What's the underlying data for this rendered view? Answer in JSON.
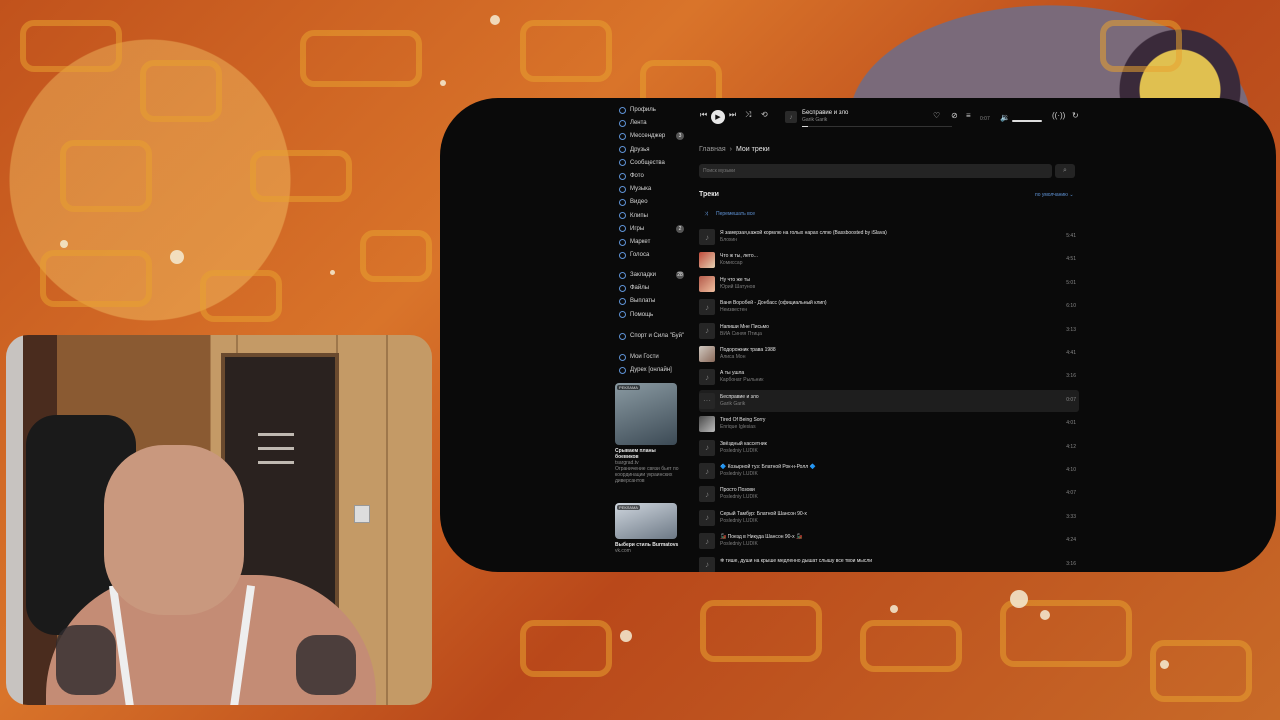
{
  "sidebar": {
    "items": [
      {
        "label": "Профиль",
        "icon": "profile-icon"
      },
      {
        "label": "Лента",
        "icon": "feed-icon"
      },
      {
        "label": "Мессенджер",
        "icon": "messenger-icon",
        "badge": "3"
      },
      {
        "label": "Друзья",
        "icon": "friends-icon"
      },
      {
        "label": "Сообщества",
        "icon": "communities-icon"
      },
      {
        "label": "Фото",
        "icon": "photo-icon"
      },
      {
        "label": "Музыка",
        "icon": "music-icon"
      },
      {
        "label": "Видео",
        "icon": "video-icon"
      },
      {
        "label": "Клипы",
        "icon": "clips-icon"
      },
      {
        "label": "Игры",
        "icon": "games-icon",
        "badge": "2"
      },
      {
        "label": "Маркет",
        "icon": "market-icon"
      },
      {
        "label": "Голоса",
        "icon": "votes-icon"
      }
    ],
    "items2": [
      {
        "label": "Закладки",
        "icon": "bookmarks-icon",
        "badge": "28"
      },
      {
        "label": "Файлы",
        "icon": "files-icon"
      },
      {
        "label": "Выплаты",
        "icon": "payments-icon"
      },
      {
        "label": "Помощь",
        "icon": "help-icon"
      }
    ],
    "group": {
      "label": "Спорт и Сила \"Буй\""
    },
    "items3": [
      {
        "label": "Мои Гости",
        "icon": "guests-icon"
      },
      {
        "label": "Дурех [онлайн]",
        "icon": "app-icon"
      }
    ],
    "ads": [
      {
        "tag": "РЕКЛАМА",
        "title": "Срываем планы боевиков",
        "domain": "tsargrad.tv",
        "desc": "Ограничение связи бьет по координации украинских диверсантов"
      },
      {
        "tag": "РЕКЛАМА",
        "title": "Выбери стиль Burmatovs",
        "domain": "vk.com",
        "desc": ""
      }
    ]
  },
  "player": {
    "title": "Бесправие и зло",
    "artist": "Garik Garik",
    "time": "0:07",
    "progress": 0.04,
    "volume": 0.8
  },
  "breadcrumb": {
    "home": "Главная",
    "current": "Мои треки"
  },
  "search": {
    "placeholder": "Поиск музыки"
  },
  "section": {
    "title": "Треки",
    "sort": "по умолчанию"
  },
  "shuffle": {
    "label": "Перемешать все"
  },
  "tracks": [
    {
      "title": "Я замерзая,кажой кормлю на голых нарах слпю (Bassboosted by iSlava)",
      "artist": "Блохин",
      "duration": "5:41",
      "cover": "note"
    },
    {
      "title": "Что ж ты, лето...",
      "artist": "Комиссар",
      "duration": "4:51",
      "cover": "photo"
    },
    {
      "title": "Ну что же ты",
      "artist": "Юрий Шатунов",
      "duration": "5:01",
      "cover": "photo"
    },
    {
      "title": "Ваня Воробей - Донбасс (официальный клип)",
      "artist": "Неизвестен",
      "duration": "6:10",
      "cover": "note"
    },
    {
      "title": "Напиши Мне Письмо",
      "artist": "ВИА Синяя Птица",
      "duration": "3:13",
      "cover": "note"
    },
    {
      "title": "Подорожник трава 1988",
      "artist": "Алиса Мон",
      "duration": "4:41",
      "cover": "photo"
    },
    {
      "title": "А ты ушла",
      "artist": "Карбонат Рыльник",
      "duration": "3:16",
      "cover": "note"
    },
    {
      "title": "Бесправие и зло",
      "artist": "Garik Garik",
      "duration": "0:07",
      "cover": "playing"
    },
    {
      "title": "Tired Of Being Sorry",
      "artist": "Enrique Iglesias",
      "duration": "4:01",
      "cover": "photo"
    },
    {
      "title": "Звёздный кассетник",
      "artist": "Posledniy LUDIK",
      "duration": "4:12",
      "cover": "note"
    },
    {
      "title": "🔷 Козырной туз: Блатной Рок-н-Ролл 🔷",
      "artist": "Posledniy LUDIK",
      "duration": "4:10",
      "cover": "note"
    },
    {
      "title": "Просто Позови",
      "artist": "Posledniy LUDIK",
      "duration": "4:07",
      "cover": "note"
    },
    {
      "title": "Серый Тамбур: Блатной Шансон 90-х",
      "artist": "Posledniy LUDIK",
      "duration": "3:33",
      "cover": "note"
    },
    {
      "title": "🚂 Поезд в Никуда Шансон 90-х 🚂",
      "artist": "Posledniy LUDIK",
      "duration": "4:24",
      "cover": "note"
    },
    {
      "title": "❄ тише, души на крыше медленно дышат слышу все твои мысли",
      "artist": "",
      "duration": "3:16",
      "cover": "note"
    }
  ],
  "colors": {
    "accent": "#5f93d6",
    "panel": "#0a0a0a",
    "text": "#e6e6e6"
  }
}
